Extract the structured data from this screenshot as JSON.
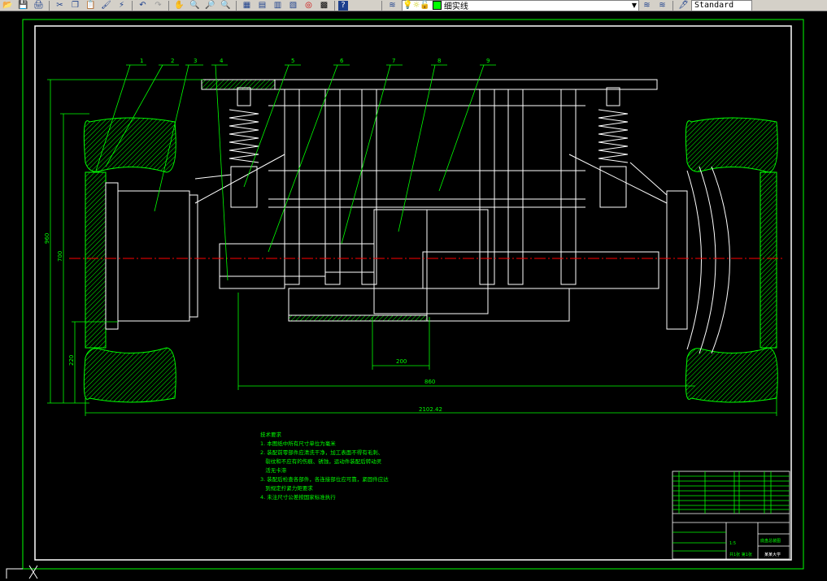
{
  "toolbar": {
    "buttons": [
      "open-icon",
      "save-icon",
      "plot-icon",
      "cut-icon",
      "copy-icon",
      "paste-icon",
      "match-properties-icon",
      "undo-icon",
      "redo-icon",
      "pan-icon",
      "zoom-realtime-icon",
      "zoom-window-icon",
      "zoom-previous-icon",
      "properties-icon",
      "design-center-icon",
      "tool-palettes-icon",
      "sheet-set-icon",
      "markup-icon",
      "calculator-icon",
      "help-icon"
    ],
    "layer_name": "细实线",
    "layer_color": "#00ff00",
    "text_style": "Standard"
  },
  "drawing": {
    "part_numbers": [
      "1",
      "2",
      "3",
      "4",
      "5",
      "6",
      "7",
      "8",
      "9"
    ],
    "dimensions": {
      "overall_height": "960",
      "upper_height": "700",
      "lower_height": "220",
      "motor_width": "200",
      "track_width": "860",
      "overall_width": "2102.42"
    },
    "tech_notes": {
      "title": "技术要求",
      "lines": [
        "1. 本图纸中所有尺寸单位为毫米",
        "2. 装配前零部件应清洗干净，加工表面不得有毛刺、",
        "   裂纹和不应有的伤痕、锈蚀，运动件装配后转动灵",
        "   活无卡滞",
        "3. 装配后检查各部件，各连接部位应可靠，紧固件应达",
        "   到规定拧紧力矩要求",
        "4. 未注尺寸公差按国家标准执行"
      ]
    },
    "title_block": {
      "drawing_name": "底盘总装图",
      "school": "某某大学",
      "scale": "1:5",
      "sheet": "共1张 第1张"
    }
  },
  "colors": {
    "background": "#000000",
    "outline": "#ffffff",
    "dimension": "#00ff00",
    "centerline": "#ff0000",
    "hatch": "#00ff00"
  }
}
